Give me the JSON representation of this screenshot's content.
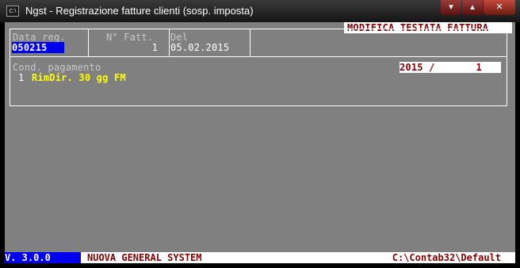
{
  "window": {
    "icon_label": "C:\\",
    "title": "Ngst - Registrazione fatture clienti (sosp. imposta)",
    "controls": {
      "minimize": "▾",
      "maximize": "▴",
      "close": "✕"
    }
  },
  "form": {
    "header_title": "MODIFICA TESTATA FATTURA",
    "data_reg": {
      "label": "Data reg.",
      "value": "050215"
    },
    "num_fatt": {
      "label": "N° Fatt.",
      "value": "1"
    },
    "del": {
      "label": "Del",
      "value": "05.02.2015"
    },
    "cond_pagamento": {
      "label": "Cond. pagamento",
      "code": "1",
      "description": "RimDir. 30 gg FM"
    },
    "protocol": "2015 /       1"
  },
  "status_bar": {
    "version": "V. 3.0.0",
    "company": "NUOVA GENERAL SYSTEM",
    "path": "C:\\Contab32\\Default"
  }
}
